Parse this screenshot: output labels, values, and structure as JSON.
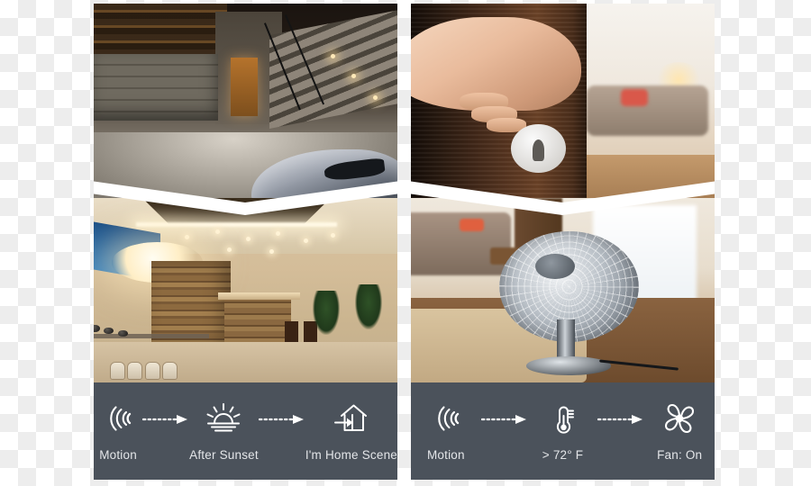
{
  "meta": {
    "layout": "two-panel smart-home automation collage",
    "caption_bar_color": "#4b525b",
    "caption_text_color": "#e3e5e8",
    "divider_color": "#ffffff"
  },
  "panels": [
    {
      "id": "lighting-automation",
      "photos": [
        {
          "name": "night-exterior-driveway",
          "alt": "Night exterior of modern home with lit staircase, garage door and silver sports car in driveway"
        },
        {
          "name": "luxury-interior-living",
          "alt": "Warmly lit luxury interior with stone bar, dining table and recessed ceiling lights"
        }
      ],
      "flow": {
        "steps": [
          {
            "icon": "motion-sensor-icon",
            "label": "Motion"
          },
          {
            "icon": "sunset-icon",
            "label": "After Sunset"
          },
          {
            "icon": "home-scene-icon",
            "label": "I'm Home Scene"
          }
        ],
        "arrows": [
          "dashed-arrow-right",
          "dashed-arrow-right"
        ]
      }
    },
    {
      "id": "climate-automation",
      "photos": [
        {
          "name": "door-entry-hand",
          "alt": "Hand gripping the handle of a dark wood door with a bright living room visible beyond"
        },
        {
          "name": "oscillating-fan-room",
          "alt": "Chrome oscillating desk fan in a living room with sofa and area rug"
        }
      ],
      "flow": {
        "steps": [
          {
            "icon": "motion-sensor-icon",
            "label": "Motion"
          },
          {
            "icon": "thermometer-icon",
            "label": "> 72° F"
          },
          {
            "icon": "fan-icon",
            "label": "Fan: On"
          }
        ],
        "arrows": [
          "dashed-arrow-right",
          "dashed-arrow-right"
        ]
      }
    }
  ]
}
